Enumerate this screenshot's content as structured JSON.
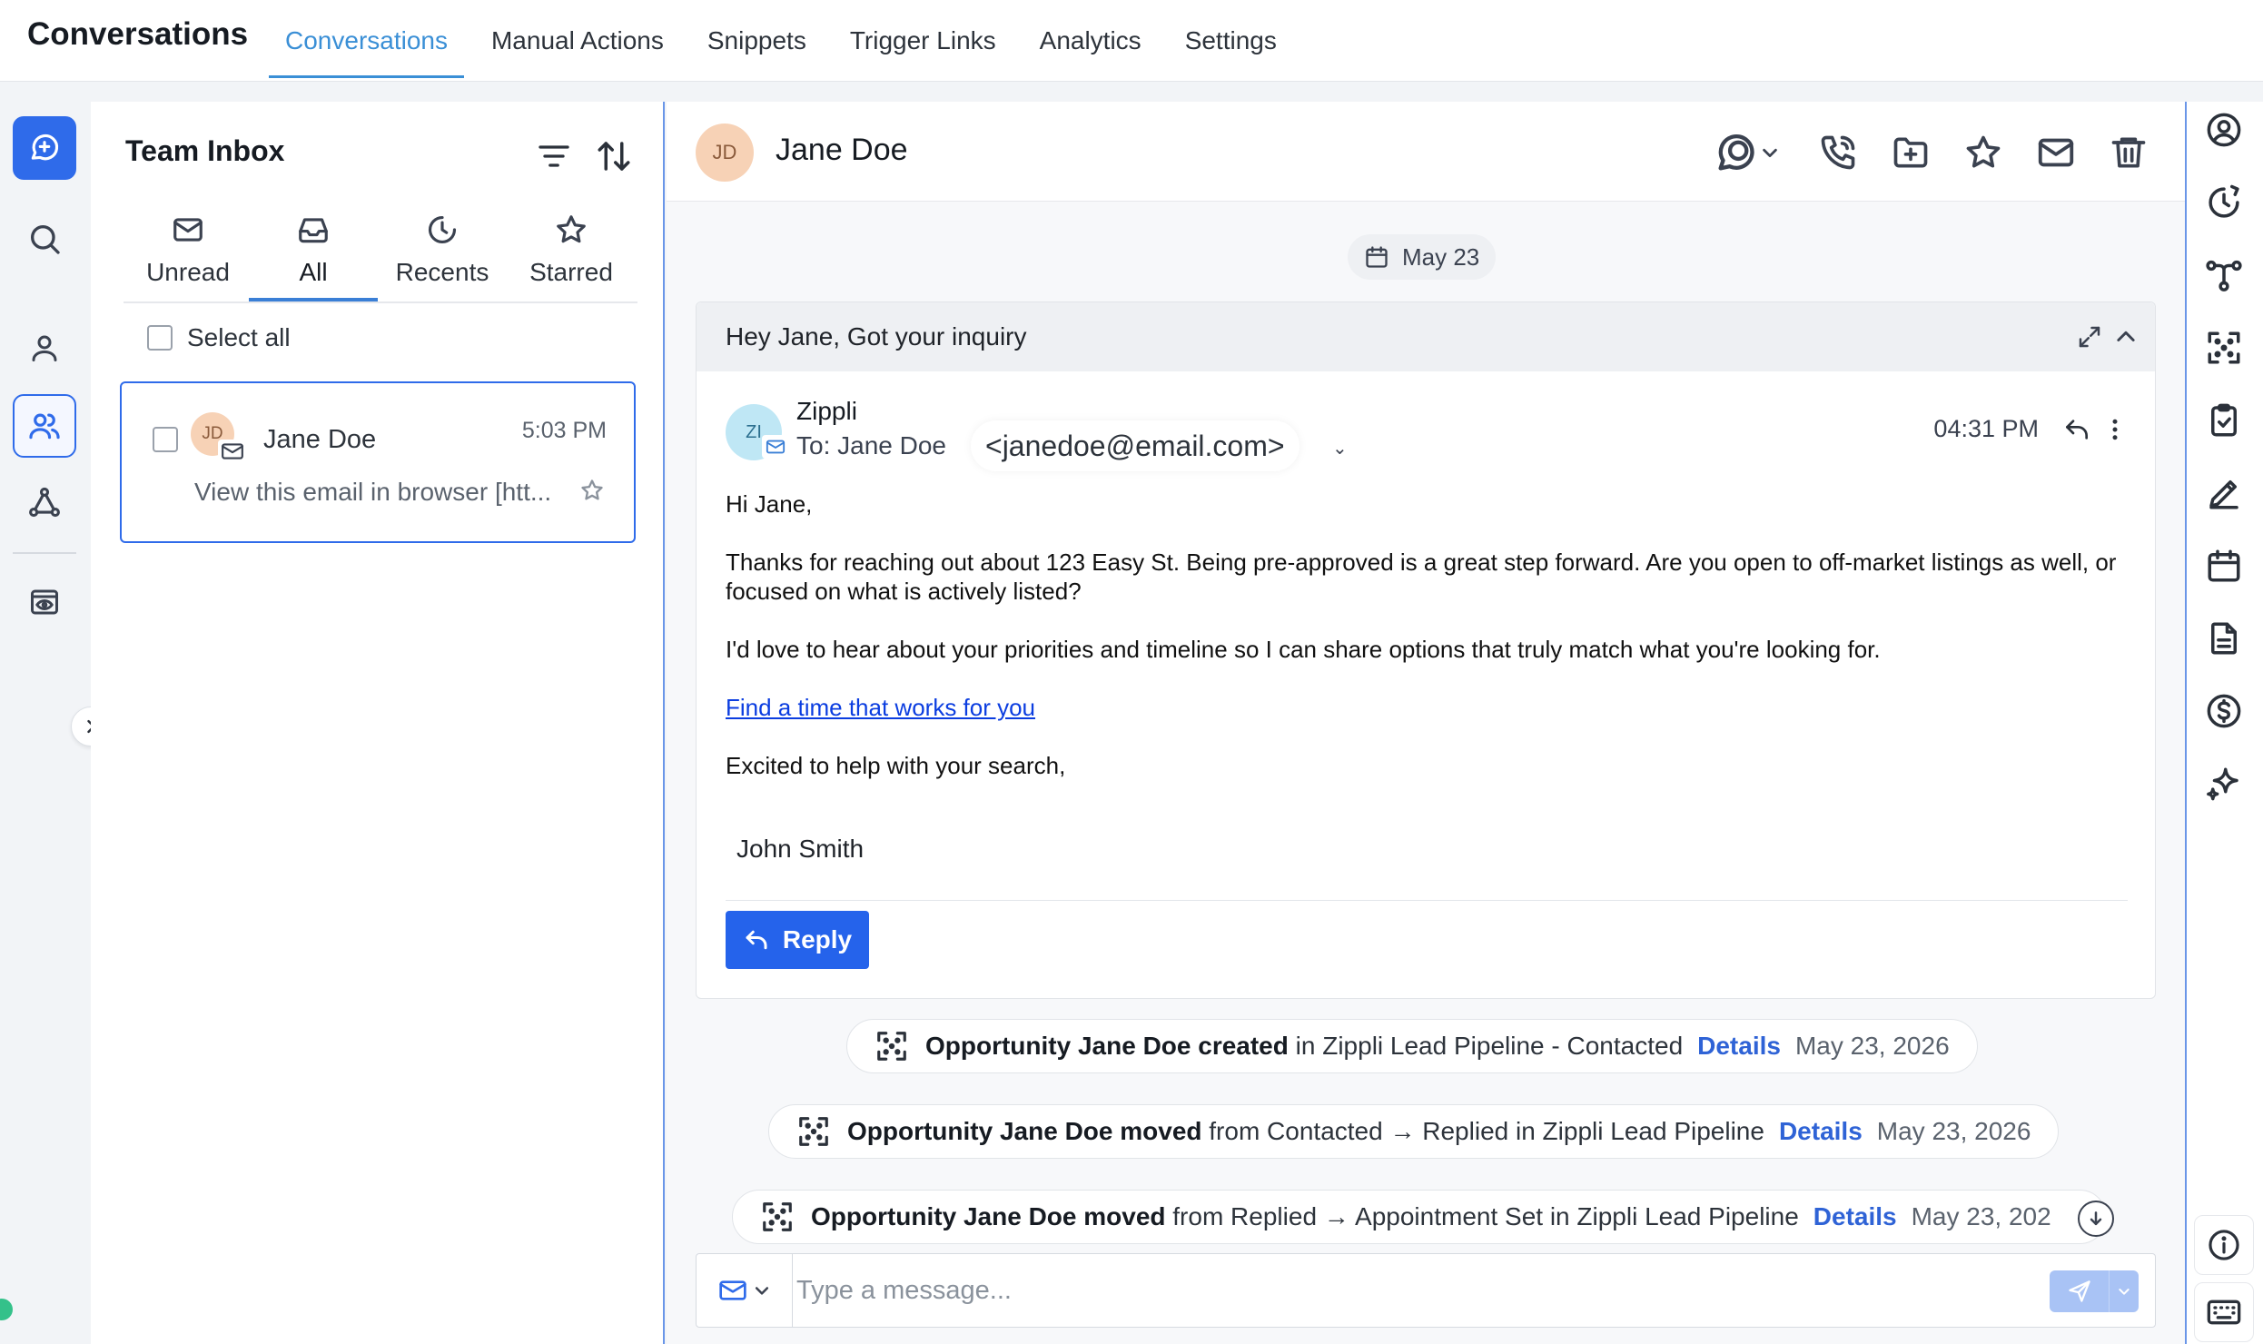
{
  "app": {
    "title": "Conversations"
  },
  "top_nav": {
    "tabs": [
      {
        "label": "Conversations",
        "active": true
      },
      {
        "label": "Manual Actions"
      },
      {
        "label": "Snippets"
      },
      {
        "label": "Trigger Links"
      },
      {
        "label": "Analytics"
      },
      {
        "label": "Settings"
      }
    ]
  },
  "left_rail": {
    "items": [
      "new-chat-icon",
      "search-icon",
      "person-icon",
      "team-icon",
      "network-icon",
      "eye-icon"
    ],
    "selected": "team-icon"
  },
  "inbox": {
    "title": "Team Inbox",
    "tabs": [
      {
        "label": "Unread",
        "icon": "mail-icon"
      },
      {
        "label": "All",
        "icon": "inbox-icon",
        "active": true
      },
      {
        "label": "Recents",
        "icon": "clock-icon"
      },
      {
        "label": "Starred",
        "icon": "star-icon"
      }
    ],
    "select_all_label": "Select all",
    "conversations": [
      {
        "initials": "JD",
        "name": "Jane Doe",
        "time": "5:03 PM",
        "preview": "View this email in browser [htt...",
        "selected": true
      }
    ]
  },
  "conversation": {
    "contact_initials": "JD",
    "contact_name": "Jane Doe",
    "header_actions": [
      "chat-icon",
      "phone-icon",
      "folder-add-icon",
      "star-icon",
      "mail-icon",
      "trash-icon"
    ],
    "date_label": "May 23",
    "email": {
      "subject": "Hey Jane, Got your inquiry",
      "sender_initials": "ZI",
      "sender_name": "Zippli",
      "to_label": "To: Jane Doe",
      "to_email": "<janedoe@email.com>",
      "time": "04:31 PM",
      "body": {
        "greeting": "Hi Jane,",
        "p1": "Thanks for reaching out about 123 Easy St. Being pre-approved is a great step forward. Are you open to off-market listings as well, or focused on what is actively listed?",
        "p2": "I'd love to hear about your priorities and timeline so I can share options that truly match what you're looking for.",
        "link": "Find a time that works for you",
        "closing": "Excited to help with your search,",
        "signature": "John Smith"
      },
      "reply_label": "Reply"
    },
    "activities": [
      {
        "bold": "Opportunity Jane Doe created",
        "text": " in Zippli Lead Pipeline - Contacted",
        "details": "Details",
        "date": "May 23, 2026"
      },
      {
        "bold": "Opportunity Jane Doe moved",
        "text": " from Contacted → Replied in Zippli Lead Pipeline",
        "details": "Details",
        "date": "May 23, 2026"
      },
      {
        "bold": "Opportunity Jane Doe moved",
        "text": " from Replied → Appointment Set in Zippli Lead Pipeline",
        "details": "Details",
        "date": "May 23, 202"
      }
    ],
    "composer": {
      "placeholder": "Type a message..."
    }
  },
  "right_rail": {
    "items": [
      "user-circle-icon",
      "history-icon",
      "workflow-icon",
      "pipeline-icon",
      "clipboard-icon",
      "pen-icon",
      "calendar-icon",
      "document-icon",
      "dollar-icon",
      "sparkle-icon"
    ],
    "bottom": [
      "info-icon",
      "keyboard-icon"
    ]
  },
  "colors": {
    "accent": "#2f6bea",
    "tab_active": "#3a8fd6",
    "link": "#0b3de0",
    "details_link": "#2f63d6"
  }
}
